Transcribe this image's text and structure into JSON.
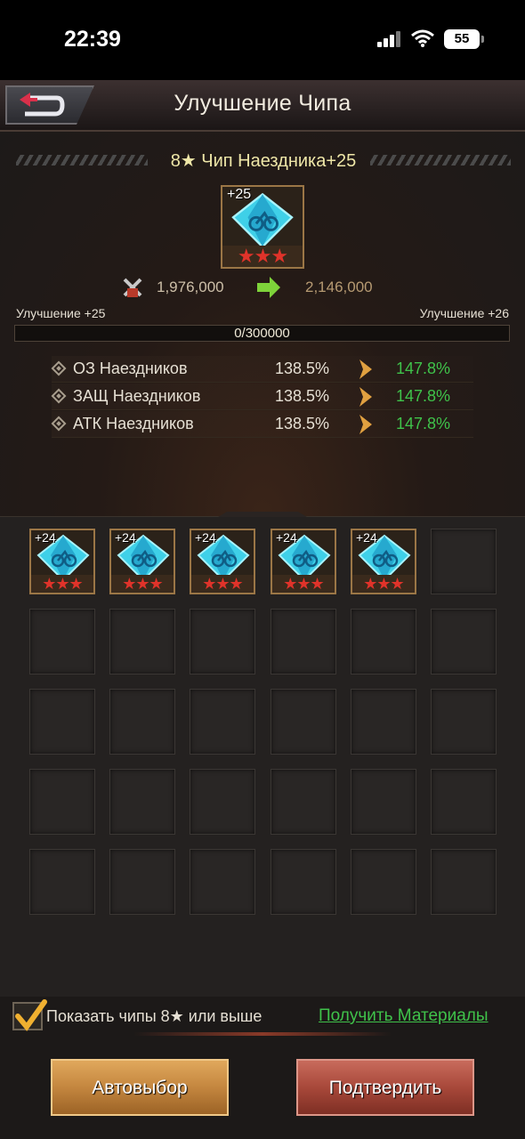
{
  "status_bar": {
    "time": "22:39",
    "battery": "55"
  },
  "header": {
    "title": "Улучшение Чипа"
  },
  "chip_info": {
    "subtitle": "8★ Чип Наездника+25",
    "level": "+25",
    "stars": "★★★",
    "power_current": "1,976,000",
    "power_next": "2,146,000",
    "level_current_label": "Улучшение +25",
    "level_next_label": "Улучшение +26",
    "progress_text": "0/300000",
    "progress_value": 0
  },
  "stats": [
    {
      "name": "ОЗ Наездников",
      "current": "138.5%",
      "next": "147.8%"
    },
    {
      "name": "ЗАЩ Наездников",
      "current": "138.5%",
      "next": "147.8%"
    },
    {
      "name": "АТК Наездников",
      "current": "138.5%",
      "next": "147.8%"
    }
  ],
  "material_chips": [
    {
      "level": "+24",
      "stars": "★★★"
    },
    {
      "level": "+24",
      "stars": "★★★"
    },
    {
      "level": "+24",
      "stars": "★★★"
    },
    {
      "level": "+24",
      "stars": "★★★"
    },
    {
      "level": "+24",
      "stars": "★★★"
    }
  ],
  "filter": {
    "label": "Показать чипы 8★ или выше",
    "checked": true
  },
  "get_materials_link": "Получить Материалы",
  "buttons": {
    "auto_select": "Автовыбор",
    "confirm": "Подтвердить"
  },
  "colors": {
    "stat_increase": "#3fc24a",
    "title_gold": "#efe7a8",
    "chip_frame": "#9b7646",
    "gem_cyan": "#3fd0e8"
  }
}
